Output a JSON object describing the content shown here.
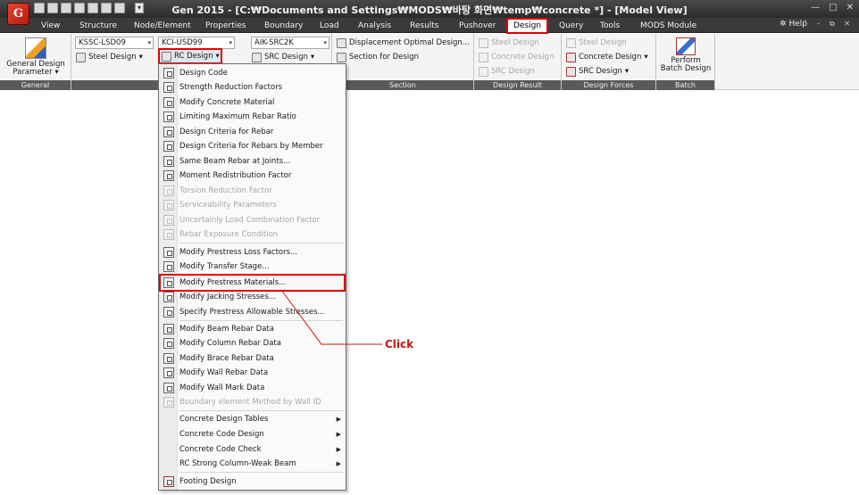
{
  "titlebar": {
    "logo_text": "G",
    "title": "Gen 2015 - [C:₩Documents and Settings₩MODS₩바탕 화면₩temp₩concrete *] - [Model View]",
    "window_controls": [
      "—",
      "□",
      "✕"
    ]
  },
  "menubar": {
    "tabs": [
      "View",
      "Structure",
      "Node/Element",
      "Properties",
      "Boundary",
      "Load",
      "Analysis",
      "Results",
      "Pushover",
      "Design",
      "Query",
      "Tools",
      "MODS Module"
    ],
    "active_tab": "Design",
    "help_label": "Help",
    "help_controls": "˅ – ⧉ ✕"
  },
  "ribbon": {
    "general": {
      "button_label_line1": "General Design",
      "button_label_line2": "Parameter",
      "footer": "General"
    },
    "steel_code_combo": "KSSC-LSD09",
    "steel_design_label": "Steel Design",
    "rc_code_combo": "KCI-USD99",
    "rc_design_label": "RC Design",
    "src_code_combo": "AIK-SRC2K",
    "src_design_label": "SRC Design",
    "section": {
      "displacement_label": "Displacement Optimal Design...",
      "section_for_design_label": "Section for Design",
      "footer": "Section"
    },
    "design_result": {
      "items": [
        "Steel Design",
        "Concrete Design",
        "SRC Design"
      ],
      "footer": "Design Result"
    },
    "design_forces": {
      "items": [
        "Steel Design",
        "Concrete Design",
        "SRC Design"
      ],
      "footer": "Design Forces"
    },
    "batch": {
      "button_line1": "Perform",
      "button_line2": "Batch Design",
      "footer": "Batch"
    }
  },
  "rc_design_menu": {
    "items": [
      {
        "label": "Design Code",
        "enabled": true
      },
      {
        "label": "Strength Reduction Factors",
        "enabled": true
      },
      {
        "label": "Modify Concrete Material",
        "enabled": true
      },
      {
        "label": "Limiting Maximum Rebar Ratio",
        "enabled": true
      },
      {
        "label": "Design Criteria for Rebar",
        "enabled": true
      },
      {
        "label": "Design Criteria for Rebars by Member",
        "enabled": true
      },
      {
        "label": "Same Beam Rebar at Joints...",
        "enabled": true
      },
      {
        "label": "Moment Redistribution Factor",
        "enabled": true
      },
      {
        "label": "Torsion Reduction Factor",
        "enabled": false
      },
      {
        "label": "Serviceability Parameters",
        "enabled": false
      },
      {
        "label": "Uncertainly Load Combination Factor",
        "enabled": false
      },
      {
        "label": "Rebar Exposure Condition",
        "enabled": false
      },
      {
        "label": "Modify Prestress Loss Factors...",
        "enabled": true
      },
      {
        "label": "Modify Transfer Stage...",
        "enabled": true
      },
      {
        "label": "Modify Prestress Materials...",
        "enabled": true
      },
      {
        "label": "Modify Jacking Stresses...",
        "enabled": true
      },
      {
        "label": "Specify Prestress Allowable Stresses...",
        "enabled": true
      },
      {
        "label": "Modify Beam Rebar Data",
        "enabled": true
      },
      {
        "label": "Modify Column Rebar Data",
        "enabled": true
      },
      {
        "label": "Modify Brace Rebar Data",
        "enabled": true
      },
      {
        "label": "Modify Wall Rebar Data",
        "enabled": true
      },
      {
        "label": "Modify Wall Mark Data",
        "enabled": true
      },
      {
        "label": "Boundary element Method by Wall ID",
        "enabled": false
      },
      {
        "label": "Concrete Design Tables",
        "enabled": true,
        "submenu": true
      },
      {
        "label": "Concrete Code Design",
        "enabled": true,
        "submenu": true
      },
      {
        "label": "Concrete Code Check",
        "enabled": true,
        "submenu": true
      },
      {
        "label": "RC Strong Column-Weak Beam",
        "enabled": true,
        "submenu": true
      },
      {
        "label": "Footing Design",
        "enabled": true
      }
    ],
    "highlighted_item": "Modify Prestress Materials..."
  },
  "annotation": {
    "label": "Click",
    "color": "#d01010"
  },
  "colors": {
    "highlight": "#e00000",
    "menubar_bg": "#3a3a3a",
    "ribbon_footer": "#5a5a5a"
  }
}
